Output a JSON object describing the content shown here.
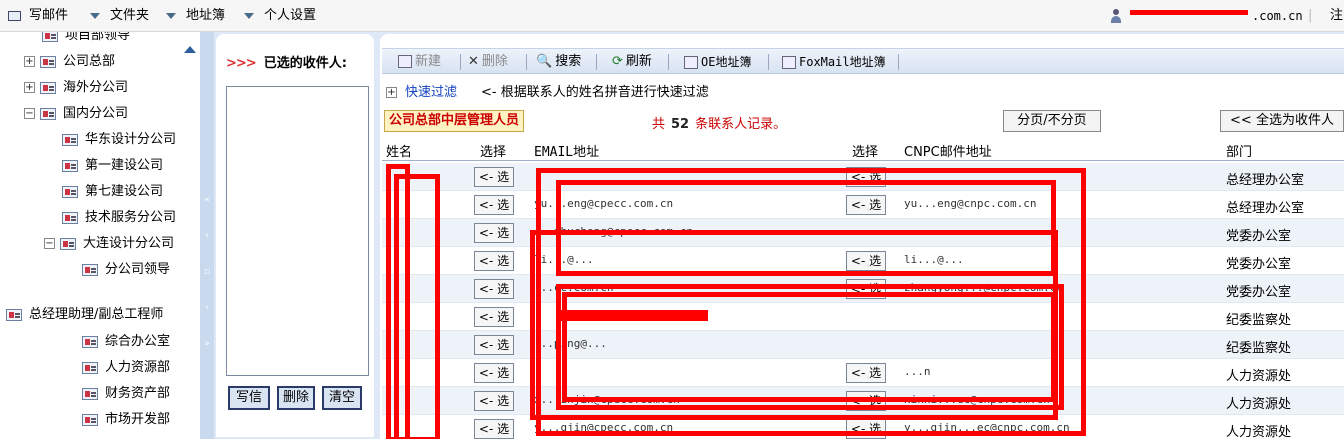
{
  "topbar": {
    "items": [
      {
        "label": "写邮件",
        "icon": "mail-icon"
      },
      {
        "label": "文件夹",
        "icon": "dropdown-arrow-icon"
      },
      {
        "label": "地址簿",
        "icon": "dropdown-arrow-icon"
      },
      {
        "label": "个人设置",
        "icon": "dropdown-arrow-icon"
      }
    ],
    "user_email_suffix": ".com.cn",
    "logout_label": "注"
  },
  "tree": {
    "items": [
      {
        "label": "项目部领导"
      },
      {
        "label": "公司总部",
        "expander": "+"
      },
      {
        "label": "海外分公司",
        "expander": "+"
      },
      {
        "label": "国内分公司",
        "expander": "−"
      },
      {
        "label": "华东设计分公司"
      },
      {
        "label": "第一建设公司"
      },
      {
        "label": "第七建设公司"
      },
      {
        "label": "技术服务分公司"
      },
      {
        "label": "大连设计分公司",
        "expander": "−"
      },
      {
        "label": "分公司领导"
      },
      {
        "label": "总经理助理/副总工程师"
      },
      {
        "label": "综合办公室"
      },
      {
        "label": "人力资源部"
      },
      {
        "label": "财务资产部"
      },
      {
        "label": "市场开发部"
      }
    ]
  },
  "recipients": {
    "title": "已选的收件人:",
    "chevrons": ">>>",
    "buttons": {
      "write": "写信",
      "delete": "删除",
      "clear": "清空"
    }
  },
  "toolbar": {
    "new": "新建",
    "delete": "删除",
    "search": "搜索",
    "refresh": "刷新",
    "oe": "OE地址簿",
    "foxmail": "FoxMail地址簿"
  },
  "filter": {
    "link": "快速过滤",
    "hint": "<- 根据联系人的姓名拼音进行快速过滤"
  },
  "group": {
    "name": "公司总部中层管理人员",
    "count_prefix": "共",
    "count": "52",
    "count_suffix": "条联系人记录。",
    "paging_button": "分页/不分页",
    "select_all_button": "<< 全选为收件人"
  },
  "table": {
    "headers": {
      "name": "姓名",
      "select1": "选择",
      "email": "EMAIL地址",
      "select2": "选择",
      "cnpc": "CNPC邮件地址",
      "dept": "部门"
    },
    "select_label": "<- 选",
    "rows": [
      {
        "email": "",
        "cnpc": "",
        "dept": "总经理办公室",
        "sel2": true
      },
      {
        "email": "yu...eng@cpecc.com.cn",
        "cnpc": "yu...eng@cnpc.com.cn",
        "dept": "总经理办公室",
        "sel2": true
      },
      {
        "email": "...zhuchong@cpecc.com.cn",
        "cnpc": "",
        "dept": "党委办公室",
        "sel2": false
      },
      {
        "email": "li...@...",
        "cnpc": "li...@...",
        "dept": "党委办公室",
        "sel2": true
      },
      {
        "email": "...cc.com.cn",
        "cnpc": "zhangyong...@cnpc.com.cn",
        "dept": "党委办公室",
        "sel2": true
      },
      {
        "email": "",
        "cnpc": "",
        "dept": "纪委监察处",
        "sel2": false
      },
      {
        "email": "...ping@...",
        "cnpc": "",
        "dept": "纪委监察处",
        "sel2": false
      },
      {
        "email": "",
        "cnpc": "...n",
        "dept": "人力资源处",
        "sel2": true
      },
      {
        "email": "x...injin@cpecc.com.cn",
        "cnpc": "xinxi...ec@cnpc.com.cn",
        "dept": "人力资源处",
        "sel2": true
      },
      {
        "email": "y...gjin@cpecc.com.cn",
        "cnpc": "y...gjin...ec@cnpc.com.cn",
        "dept": "人力资源处",
        "sel2": true
      }
    ]
  }
}
